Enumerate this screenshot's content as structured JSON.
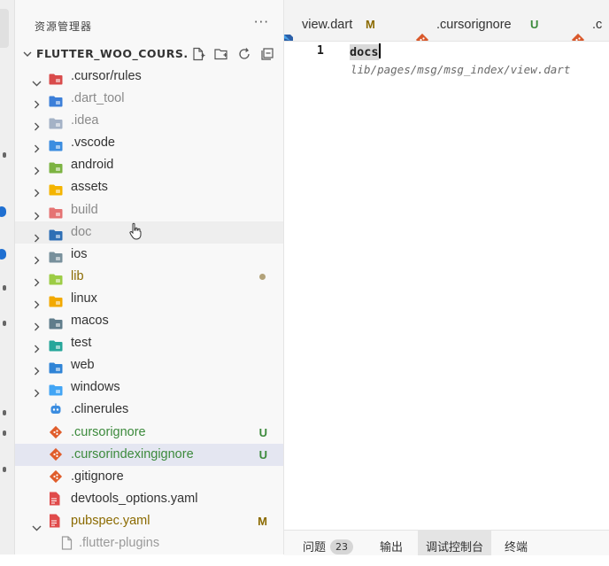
{
  "explorer": {
    "title": "资源管理器",
    "more": "···",
    "section_title": "FLUTTER_WOO_COURS..."
  },
  "tree": [
    {
      "label": ".cursor/rules",
      "icon": "folder-icon",
      "color": "#d94b4b",
      "expanded": true,
      "state": "normal"
    },
    {
      "label": ".dart_tool",
      "icon": "folder-icon",
      "color": "#3c7fd9",
      "state": "dim"
    },
    {
      "label": ".idea",
      "icon": "folder-icon",
      "color": "#a4b2c6",
      "state": "dim"
    },
    {
      "label": ".vscode",
      "icon": "folder-icon",
      "color": "#3b8de0",
      "state": "normal"
    },
    {
      "label": "android",
      "icon": "folder-icon",
      "color": "#7cb342",
      "state": "normal"
    },
    {
      "label": "assets",
      "icon": "folder-icon",
      "color": "#f4b400",
      "state": "normal"
    },
    {
      "label": "build",
      "icon": "folder-icon",
      "color": "#e57373",
      "state": "dim"
    },
    {
      "label": "doc",
      "icon": "folder-icon",
      "color": "#2e6fb5",
      "state": "dim",
      "hover": true
    },
    {
      "label": "ios",
      "icon": "folder-icon",
      "color": "#78909c",
      "state": "normal"
    },
    {
      "label": "lib",
      "icon": "folder-icon",
      "color": "#9ccc45",
      "state": "lib",
      "dot": true
    },
    {
      "label": "linux",
      "icon": "folder-icon",
      "color": "#f2a900",
      "state": "normal"
    },
    {
      "label": "macos",
      "icon": "folder-icon",
      "color": "#607d8b",
      "state": "normal"
    },
    {
      "label": "test",
      "icon": "folder-icon",
      "color": "#26a69a",
      "state": "normal"
    },
    {
      "label": "web",
      "icon": "folder-icon",
      "color": "#2f84d6",
      "state": "normal"
    },
    {
      "label": "windows",
      "icon": "folder-icon",
      "color": "#42a5f5",
      "state": "normal"
    },
    {
      "label": ".clinerules",
      "icon": "robot-icon",
      "color": "#3b8de0",
      "state": "normal",
      "file": true
    },
    {
      "label": ".cursorignore",
      "icon": "git-icon",
      "color": "#e05d2b",
      "state": "untracked",
      "file": true,
      "badge": "U"
    },
    {
      "label": ".cursorindexingignore",
      "icon": "git-icon",
      "color": "#e05d2b",
      "state": "untracked",
      "file": true,
      "badge": "U",
      "selected": true
    },
    {
      "label": ".gitignore",
      "icon": "git-icon",
      "color": "#e05d2b",
      "state": "normal",
      "file": true
    },
    {
      "label": "devtools_options.yaml",
      "icon": "yaml-file-icon",
      "color": "#e04b4b",
      "state": "normal",
      "file": true
    },
    {
      "label": "pubspec.yaml",
      "icon": "yaml-file-icon",
      "color": "#e04b4b",
      "state": "modified",
      "file": true,
      "badge": "M",
      "expanded": true,
      "chevron": true
    },
    {
      "label": ".flutter-plugins",
      "icon": "file-icon",
      "color": "#9a9a9a",
      "state": "faded",
      "file": true,
      "nested": true
    }
  ],
  "tabs": [
    {
      "label": "view.dart",
      "status": "M",
      "icon": "dart-icon",
      "status_color": "#8b6a00"
    },
    {
      "label": ".cursorignore",
      "status": "U",
      "icon": "git-icon",
      "status_color": "#3c8a3c"
    },
    {
      "label": ".c",
      "status": "",
      "icon": "git-icon",
      "status_color": ""
    }
  ],
  "editor": {
    "line_number": "1",
    "text": "docs",
    "ghost_text": "lib/pages/msg/msg_index/view.dart"
  },
  "panel": {
    "tabs": [
      "问题",
      "输出",
      "调试控制台",
      "终端"
    ],
    "problems_count": "23",
    "active_tab": "调试控制台"
  }
}
